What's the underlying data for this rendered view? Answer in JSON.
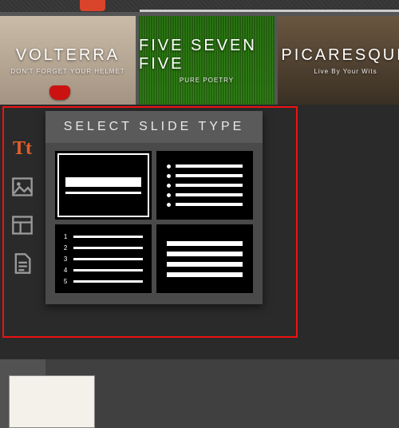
{
  "themes": [
    {
      "title": "VOLTERRA",
      "subtitle": "DON'T FORGET YOUR HELMET"
    },
    {
      "title": "FIVE SEVEN FIVE",
      "subtitle": "PURE POETRY"
    },
    {
      "title": "PICARESQUE",
      "subtitle": "Live By Your Wits"
    }
  ],
  "panel": {
    "title": "SELECT SLIDE TYPE"
  },
  "tools": {
    "text": "Tt"
  },
  "slide_options": [
    {
      "id": "title",
      "selected": true
    },
    {
      "id": "bullets",
      "selected": false
    },
    {
      "id": "numbered",
      "selected": false
    },
    {
      "id": "paragraph",
      "selected": false
    }
  ]
}
